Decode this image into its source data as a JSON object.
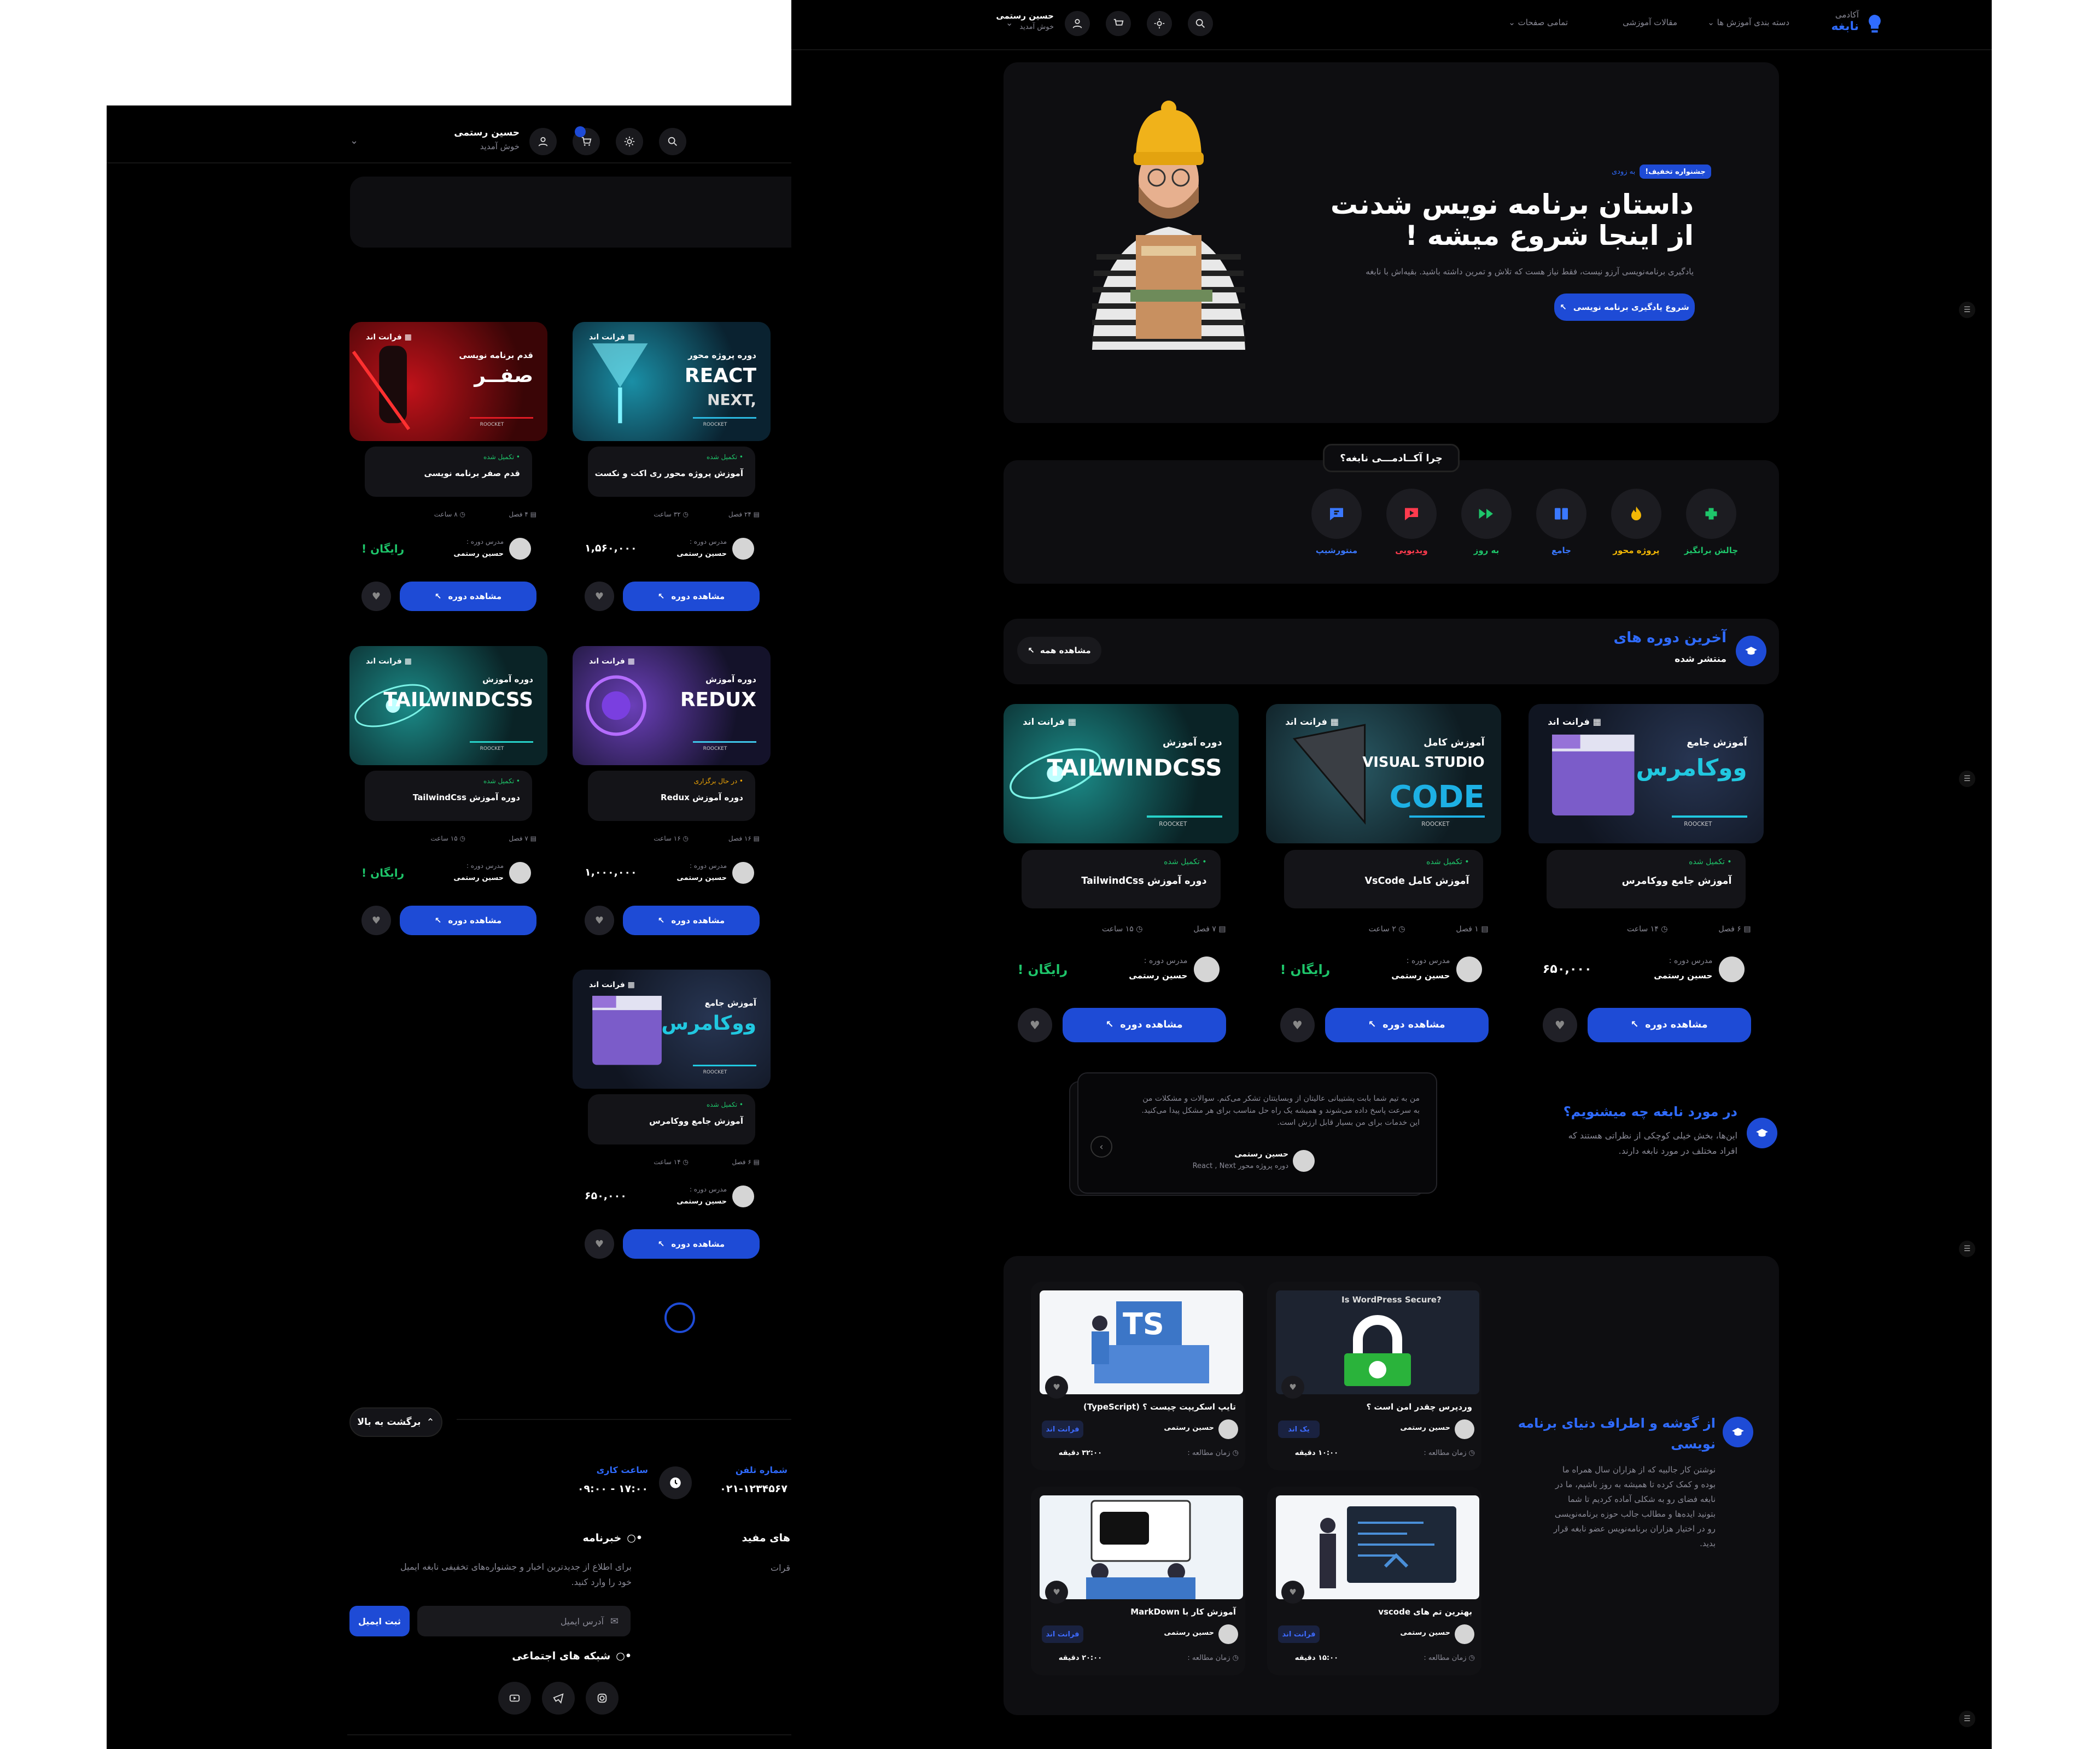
{
  "header": {
    "user_name": "حسین رستمی",
    "welcome": "خوش آمدید",
    "logo_small": "آکادمی",
    "logo_big": "نابغه",
    "nav": [
      "دسته بندی آموزش ها",
      "مقالات آموزشی",
      "تمامی صفحات"
    ]
  },
  "hero": {
    "badge": "جشنواره تخفیف!",
    "badge_note": "به زودی",
    "title1": "داستان برنامه نویس شدنت",
    "title2": "از اینجا شروع میشه !",
    "desc": "یادگیری برنامه‌نویسی آرزو نیست، فقط نیاز هست که تلاش و تمرین داشته باشید. بقیه‌اش با نابغه",
    "cta": "شروع یادگیری برنامه نویسی"
  },
  "why": {
    "title": "چرا آکــادمـــی نابغه؟",
    "items": [
      {
        "label": "چالش برانگیز",
        "color": "#1ec56a",
        "icon": "puzzle-icon"
      },
      {
        "label": "پروژه محور",
        "color": "#f2b705",
        "icon": "fire-icon"
      },
      {
        "label": "جامع",
        "color": "#3a78ff",
        "icon": "book-icon"
      },
      {
        "label": "به روز",
        "color": "#1ec56a",
        "icon": "forward-icon"
      },
      {
        "label": "ویدیویی",
        "color": "#ff3b4e",
        "icon": "video-icon"
      },
      {
        "label": "منتورشیپ",
        "color": "#3a78ff",
        "icon": "chat-icon"
      }
    ]
  },
  "latest": {
    "title": "آخرین دوره های",
    "subtitle": "منتشر شده",
    "view_all": "مشاهده همه"
  },
  "labels": {
    "teacher_role": "مدرس دوره :",
    "teacher": "حسین رستمی",
    "view_course": "مشاهده دوره",
    "free": "رایگان !",
    "category": "فرانت اند",
    "chapters_suffix": "فصل",
    "hours_suffix": "ساعت"
  },
  "right_courses": [
    {
      "title": "آموزش جامع ووکامرس",
      "status": "تکمیل شده",
      "status_color": "#1ec56a",
      "chapters": "۶",
      "hours": "۱۴",
      "price": "۶۵۰,۰۰۰",
      "art": "woo"
    },
    {
      "title": "آموزش کامل VsCode",
      "status": "تکمیل شده",
      "status_color": "#1ec56a",
      "chapters": "۱",
      "hours": "۲",
      "price": "رایگان !",
      "art": "vscode"
    },
    {
      "title": "دوره آموزش TailwindCss",
      "status": "تکمیل شده",
      "status_color": "#1ec56a",
      "chapters": "۷",
      "hours": "۱۵",
      "price": "رایگان !",
      "art": "tailwind"
    }
  ],
  "left_courses": [
    {
      "title": "آموزش پروژه محور ری اکت و نکست",
      "status": "تکمیل شده",
      "status_color": "#1ec56a",
      "chapters": "۲۴",
      "hours": "۳۲",
      "price": "۱,۵۶۰,۰۰۰",
      "art": "react"
    },
    {
      "title": "قدم صفر برنامه نویسی",
      "status": "تکمیل شده",
      "status_color": "#1ec56a",
      "chapters": "۴",
      "hours": "۸",
      "price": "رایگان !",
      "art": "zero"
    },
    {
      "title": "دوره آموزش Redux",
      "status": "در حال برگزاری",
      "status_color": "#f2a705",
      "chapters": "۱۶",
      "hours": "۱۶",
      "price": "۱,۰۰۰,۰۰۰",
      "art": "redux"
    },
    {
      "title": "دوره آموزش TailwindCss",
      "status": "تکمیل شده",
      "status_color": "#1ec56a",
      "chapters": "۷",
      "hours": "۱۵",
      "price": "رایگان !",
      "art": "tailwind"
    },
    {
      "title": "آموزش جامع ووکامرس",
      "status": "تکمیل شده",
      "status_color": "#1ec56a",
      "chapters": "۶",
      "hours": "۱۴",
      "price": "۶۵۰,۰۰۰",
      "art": "woo"
    }
  ],
  "thumbs": {
    "woo": {
      "small": "آموزش جامع",
      "big": "ووکامرس",
      "brand": "ROOCKET"
    },
    "vscode": {
      "small": "آموزش کامل",
      "big": "VISUAL STUDIO",
      "big2": "CODE",
      "brand": "ROOCKET"
    },
    "tailwind": {
      "small": "دوره آموزش",
      "big": "TAILWINDCSS",
      "brand": "ROOCKET"
    },
    "react": {
      "small": "دوره پروژه محور",
      "big": "REACT",
      "big2": "NEXT,",
      "brand": "ROOCKET"
    },
    "zero": {
      "small": "قدم  برنامه نویسی",
      "big": "صفــر",
      "brand": "ROOCKET"
    },
    "redux": {
      "small": "دوره آموزش",
      "big": "REDUX",
      "brand": "ROOCKET"
    }
  },
  "testimonials": {
    "title": "در مورد نابغه چه میشنویم؟",
    "desc1": "این‌ها، بخش خیلی کوچکی از نظراتی هستند که",
    "desc2": "افراد مختلف در مورد نابغه دارند.",
    "quote1": "من به تیم شما بابت پشتیبانی عالیتان از وبسایتتان تشکر می‌کنم. سوالات و مشکلات من",
    "quote2": "به سرعت پاسخ داده می‌شوند و همیشه یک راه حل مناسب برای هر مشکل پیدا می‌کنید.",
    "quote3": "این خدمات برای من بسیار قابل ارزش است.",
    "name": "حسین رستمی",
    "course": "دوره پروژه محور React , Next"
  },
  "articles": {
    "title1": "از گوشه و اطراف دنیای برنامه",
    "title2": "نویسی",
    "desc": [
      "نوشتن کار جالبیه که از هزاران سال همراه ما",
      "بوده و کمک کرده تا همیشه به روز باشیم، ما در",
      "نابغه فضای رو به شکلی آماده کردیم تا شما",
      "بتونید ایده‌ها و مطالب جالب حوزه برنامه‌نویسی",
      "رو در اختیار هزاران برنامه‌نویس عضو نابغه قرار",
      "بدید."
    ],
    "read_label": "زمان مطالعه :",
    "minutes": "دقیقه",
    "items": [
      {
        "title": "وردپرس چقدر امن است ؟",
        "tag": "یک اند",
        "time": "۱۰:۰۰",
        "art": "wp",
        "art_text": "Is WordPress Secure?"
      },
      {
        "title": "تایپ اسکریپت چیست ؟ (TypeScript)",
        "tag": "فرانت اند",
        "time": "۳۲:۰۰",
        "art": "ts",
        "art_text": "TS"
      },
      {
        "title": "بهترین تم های vscode",
        "tag": "فرانت اند",
        "time": "۱۵:۰۰",
        "art": "vst"
      },
      {
        "title": "آموزش کار با MarkDown",
        "tag": "فرانت اند",
        "time": "۲۰:۰۰",
        "art": "md"
      }
    ]
  },
  "footer": {
    "back_top": "برگشت به بالا",
    "phone_label": "شماره تلفن",
    "phone": "۰۲۱-۱۲۳۴۵۶۷",
    "hours_label": "ساعت کاری",
    "hours": "۰۹:۰۰ - ۱۷:۰۰",
    "useful": "های مفید",
    "useful_item": "قرات",
    "newsletter": "خبرنامه",
    "newsletter_desc1": "برای اطلاع از جدیدترین اخبار و جشنواره‌های تخفیفی نابغه ایمیل",
    "newsletter_desc2": "خود را وارد کنید.",
    "email_placeholder": "آدرس ایمیل",
    "submit": "ثبت ایمیل",
    "social": "شبکه های اجتماعی"
  },
  "colors": {
    "accent": "#1e4bd6",
    "bg": "#000000",
    "panel": "#0e0e11"
  }
}
